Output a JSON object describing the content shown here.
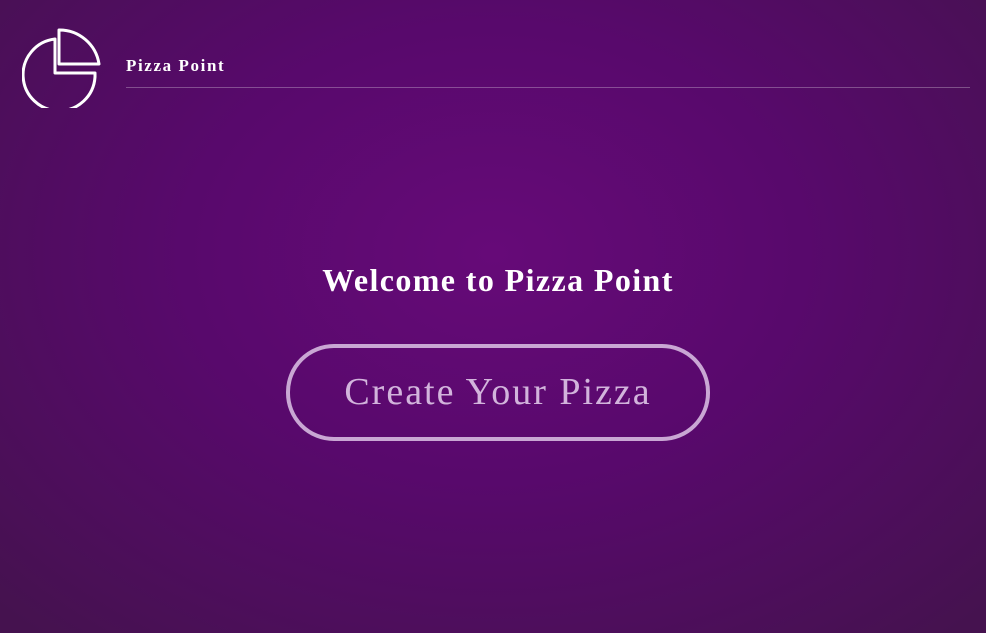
{
  "header": {
    "logo_icon": "pizza-slice-icon",
    "brand_name": "Pizza Point"
  },
  "hero": {
    "welcome_text": "Welcome to Pizza Point",
    "cta_label": "Create Your Pizza"
  },
  "colors": {
    "background_center": "#660a78",
    "background_edge": "#45124f",
    "text": "#ffffff",
    "button_outline": "#c9a7d4"
  }
}
